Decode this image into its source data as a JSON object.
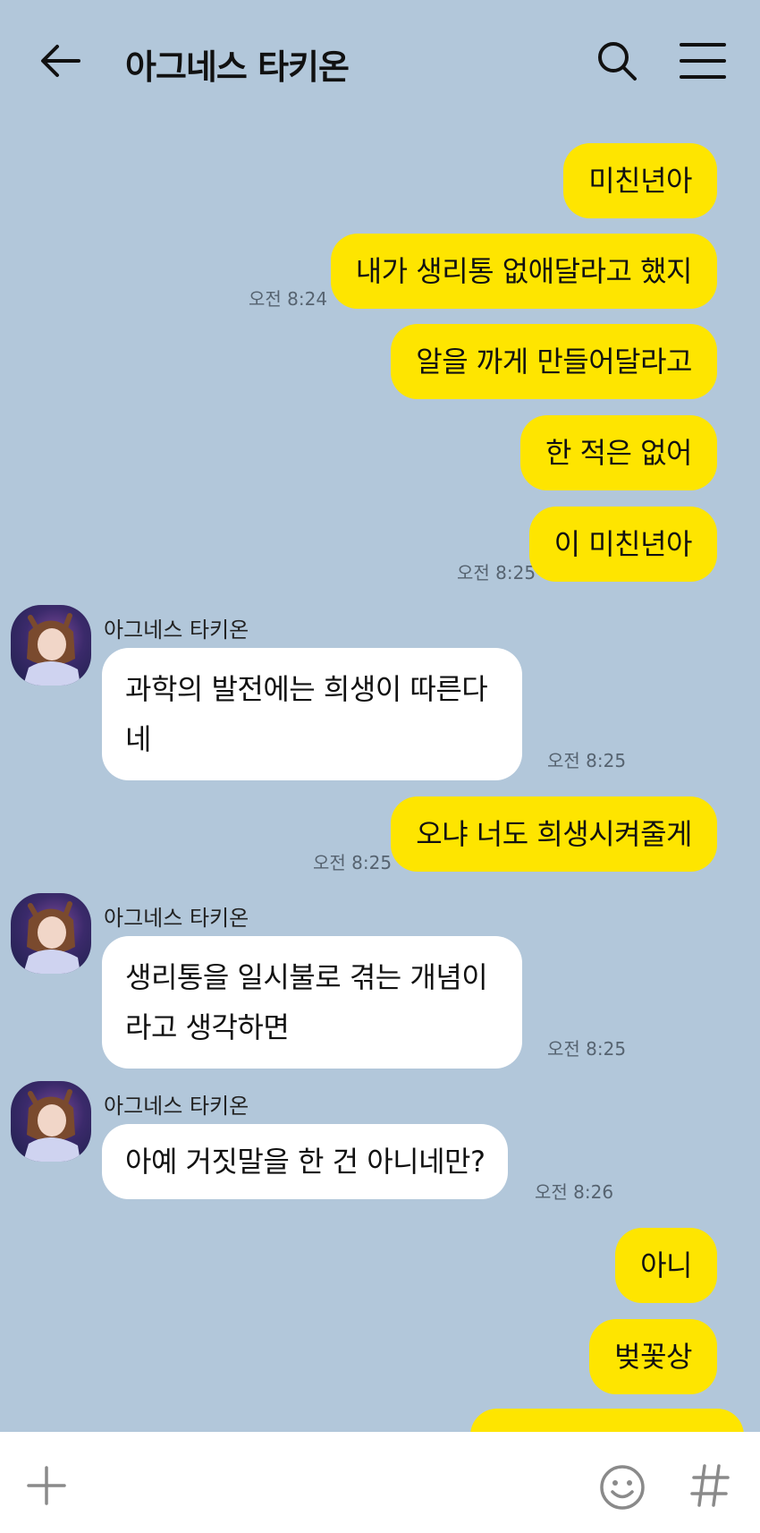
{
  "header": {
    "title": "아그네스 타키온",
    "back_icon": "arrow-left-icon",
    "search_icon": "search-icon",
    "menu_icon": "hamburger-menu-icon"
  },
  "messages": {
    "m1": "미친년아",
    "m2": "내가 생리통 없애달라고 했지",
    "t2": "오전 8:24",
    "m3": "알을 까게 만들어달라고",
    "m4": "한 적은 없어",
    "m5": "이 미친년아",
    "t5": "오전 8:25",
    "s6": "아그네스 타키온",
    "m6": "과학의 발전에는 희생이 따른다네",
    "t6": "오전 8:25",
    "m7": "오냐 너도 희생시켜줄게",
    "t7": "오전 8:25",
    "s8": "아그네스 타키온",
    "m8": "생리통을 일시불로 겪는 개념이라고 생각하면",
    "t8": "오전 8:25",
    "s9": "아그네스 타키온",
    "m9": "아예 거짓말을 한 건 아니네만?",
    "t9": "오전 8:26",
    "m10": "아니",
    "m11": "벚꽃상"
  },
  "input_bar": {
    "plus_icon": "plus-icon",
    "emoji_icon": "emoji-smile-icon",
    "hash_icon": "hashtag-icon"
  },
  "colors": {
    "background": "#b2c7da",
    "my_bubble": "#fee500",
    "their_bubble": "#ffffff"
  }
}
